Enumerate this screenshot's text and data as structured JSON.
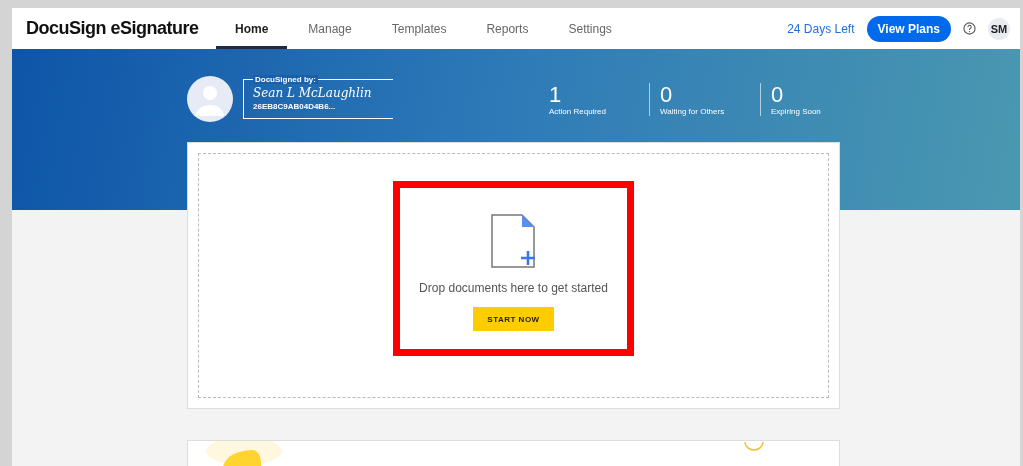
{
  "brand": "DocuSign eSignature",
  "tabs": [
    {
      "label": "Home",
      "selected": true
    },
    {
      "label": "Manage",
      "selected": false
    },
    {
      "label": "Templates",
      "selected": false
    },
    {
      "label": "Reports",
      "selected": false
    },
    {
      "label": "Settings",
      "selected": false
    }
  ],
  "trial": "24 Days Left",
  "plans_button": "View Plans",
  "user_initials": "SM",
  "signature": {
    "caption": "DocuSigned by:",
    "name": "Sean L McLaughlin",
    "id": "26EB8C9AB04D4B6..."
  },
  "stats": [
    {
      "value": "1",
      "label": "Action Required"
    },
    {
      "value": "0",
      "label": "Waiting for Others"
    },
    {
      "value": "0",
      "label": "Expiring Soon"
    }
  ],
  "dropzone": {
    "text": "Drop documents here to get started",
    "button": "START NOW",
    "highlighted": true
  }
}
